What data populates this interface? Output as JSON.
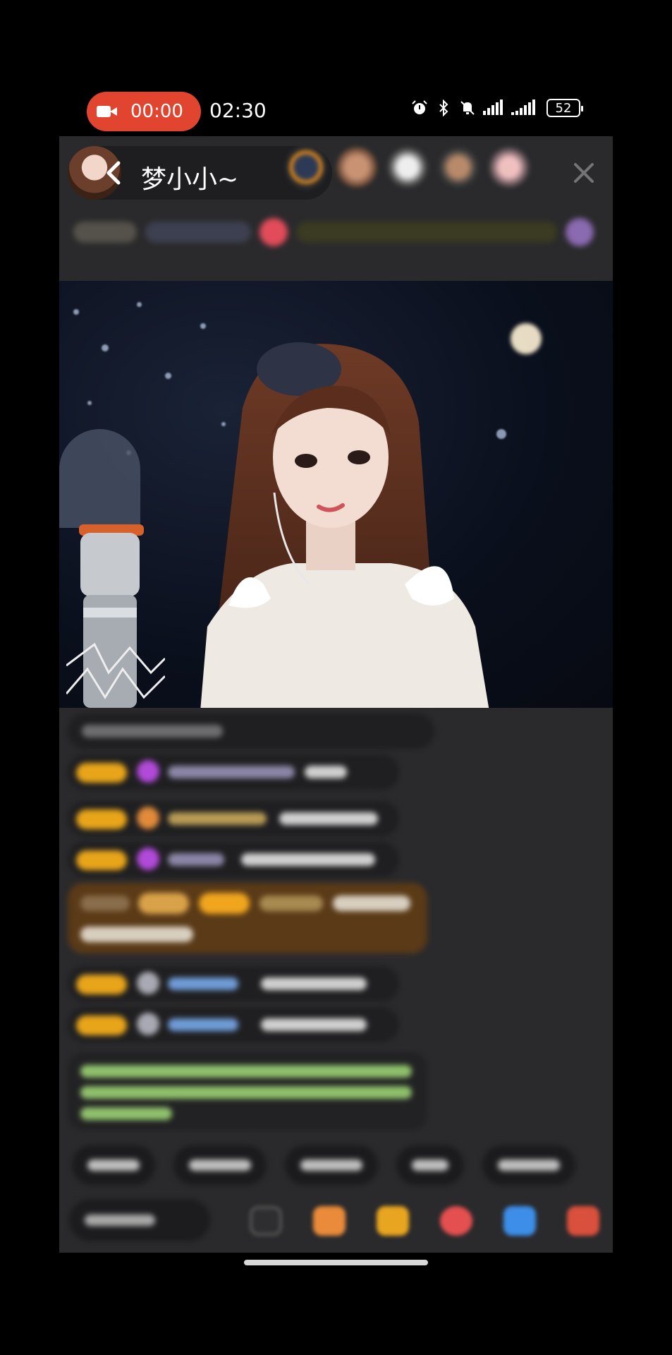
{
  "status_bar": {
    "recording_time": "00:00",
    "clock": "02:30",
    "battery": "52",
    "icons": [
      "alarm-icon",
      "bluetooth-icon",
      "mute-icon",
      "signal-icon",
      "signal-icon"
    ]
  },
  "header": {
    "host_name": "梦小小~"
  },
  "colors": {
    "recording": "#e2452f",
    "background": "#2a2a2c",
    "level_badge": "#e8a51a",
    "gift_message": "#5a3a17",
    "system_message_text": "#8fc06b"
  },
  "bottom_bar": {
    "icons": [
      "more-icon",
      "gift-box-icon",
      "red-packet-icon",
      "game-icon",
      "controller-icon",
      "shop-icon"
    ]
  }
}
